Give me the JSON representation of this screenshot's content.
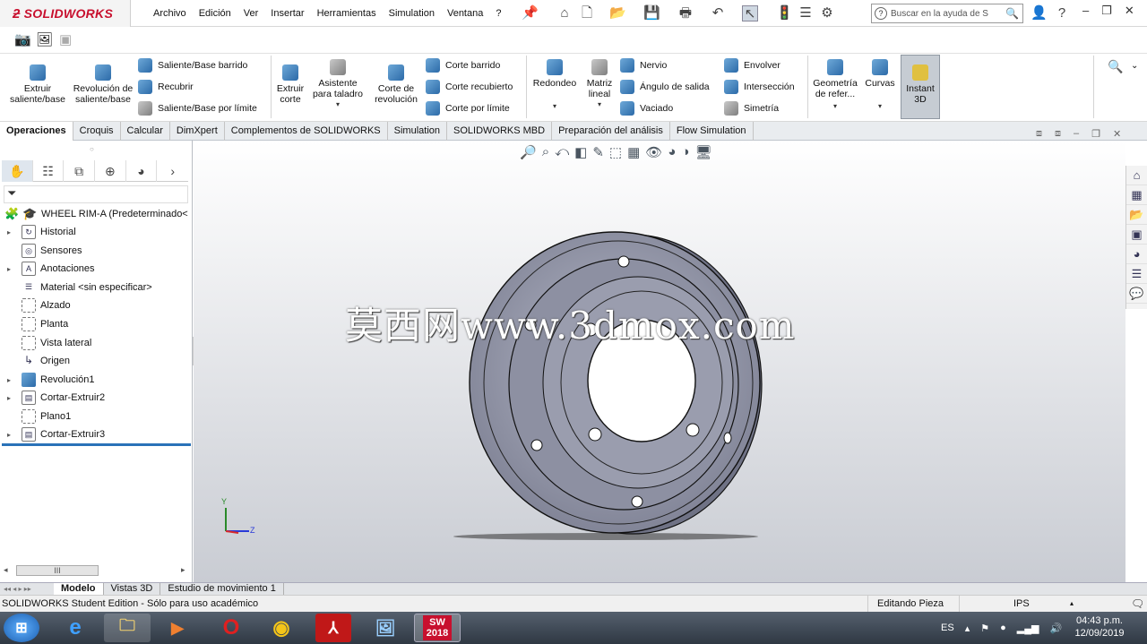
{
  "app": {
    "brand": "SOLIDWORKS",
    "accent": "#c8102e"
  },
  "menu": [
    "Archivo",
    "Edición",
    "Ver",
    "Insertar",
    "Herramientas",
    "Simulation",
    "Ventana",
    "?"
  ],
  "search": {
    "placeholder": "Buscar en la ayuda de S"
  },
  "ribbon": {
    "extrude": "Extruir saliente/base",
    "revolve": "Revolución de saliente/base",
    "swept_boss": "Saliente/Base barrido",
    "loft": "Recubrir",
    "boundary_boss": "Saliente/Base por límite",
    "extrude_cut": "Extruir corte",
    "hole_wizard": "Asistente para taladro",
    "revolve_cut": "Corte de revolución",
    "swept_cut": "Corte barrido",
    "lofted_cut": "Corte recubierto",
    "boundary_cut": "Corte por límite",
    "fillet": "Redondeo",
    "linear_pattern": "Matriz lineal",
    "rib": "Nervio",
    "draft": "Ángulo de salida",
    "shell": "Vaciado",
    "wrap": "Envolver",
    "intersect": "Intersección",
    "mirror": "Simetría",
    "ref_geometry": "Geometría de refer...",
    "curves": "Curvas",
    "instant3d": "Instant 3D"
  },
  "tabs": [
    "Operaciones",
    "Croquis",
    "Calcular",
    "DimXpert",
    "Complementos de SOLIDWORKS",
    "Simulation",
    "SOLIDWORKS MBD",
    "Preparación del análisis",
    "Flow Simulation"
  ],
  "tree": {
    "root": "WHEEL RIM-A  (Predeterminado<",
    "items": [
      {
        "label": "Historial",
        "expandable": true,
        "icon": "history-icon"
      },
      {
        "label": "Sensores",
        "expandable": false,
        "icon": "sensor-icon"
      },
      {
        "label": "Anotaciones",
        "expandable": true,
        "icon": "annotation-icon"
      },
      {
        "label": "Material <sin especificar>",
        "expandable": false,
        "icon": "material-icon"
      },
      {
        "label": "Alzado",
        "expandable": false,
        "icon": "plane-icon"
      },
      {
        "label": "Planta",
        "expandable": false,
        "icon": "plane-icon"
      },
      {
        "label": "Vista lateral",
        "expandable": false,
        "icon": "plane-icon"
      },
      {
        "label": "Origen",
        "expandable": false,
        "icon": "origin-icon"
      },
      {
        "label": "Revolución1",
        "expandable": true,
        "icon": "revolve-icon"
      },
      {
        "label": "Cortar-Extruir2",
        "expandable": true,
        "icon": "cut-extrude-icon"
      },
      {
        "label": "Plano1",
        "expandable": false,
        "icon": "plane-icon"
      },
      {
        "label": "Cortar-Extruir3",
        "expandable": true,
        "icon": "cut-extrude-icon"
      }
    ]
  },
  "viewport": {
    "watermark": "莫西网www.3dmox.com",
    "axis_y": "Y",
    "axis_z": "Z"
  },
  "bottom_tabs": [
    "Modelo",
    "Vistas 3D",
    "Estudio de movimiento 1"
  ],
  "status": {
    "left": "SOLIDWORKS Student Edition - Sólo para uso académico",
    "mode": "Editando Pieza",
    "units": "IPS"
  },
  "taskbar": {
    "lang": "ES",
    "time": "04:43 p.m.",
    "date": "12/09/2019",
    "sw_badge": "2018"
  }
}
